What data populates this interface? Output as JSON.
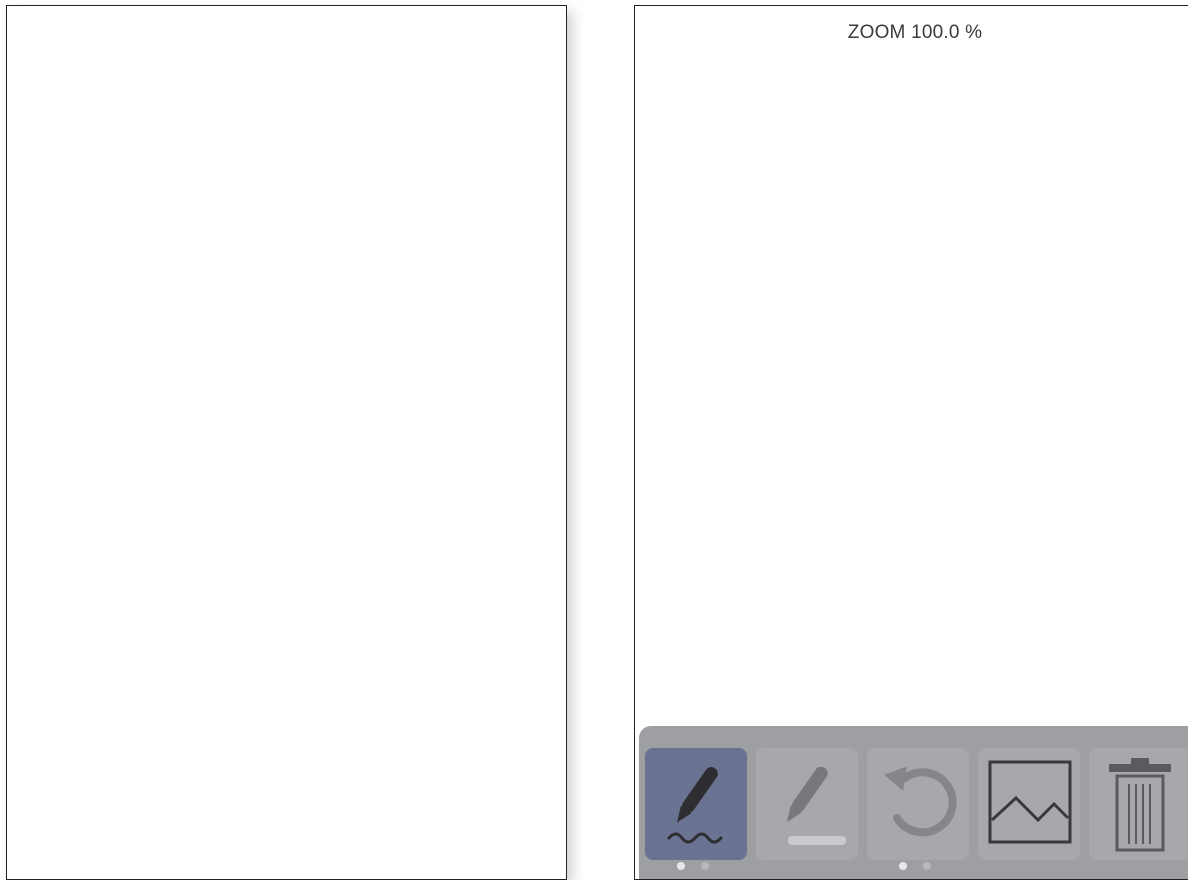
{
  "right_screen": {
    "zoom_label": "ZOOM 100.0 %"
  },
  "toolbar": {
    "buttons": [
      {
        "name": "signature-pen",
        "icon": "pen-signature-icon",
        "active": true
      },
      {
        "name": "highlighter",
        "icon": "highlighter-icon",
        "active": false
      },
      {
        "name": "undo",
        "icon": "undo-icon",
        "active": false
      },
      {
        "name": "image",
        "icon": "image-icon",
        "active": false
      },
      {
        "name": "delete",
        "icon": "trash-icon",
        "active": false
      }
    ],
    "page_indicator_groups": [
      {
        "dots": 2,
        "active_index": 0
      },
      {
        "dots": 2,
        "active_index": 0
      }
    ]
  },
  "colors": {
    "toolbar_bg": "#9e9fa3",
    "button_bg": "#a7a8ac",
    "active_button_bg": "#6a7391",
    "icon_dark": "#2e2e32",
    "icon_muted": "#77787c"
  }
}
